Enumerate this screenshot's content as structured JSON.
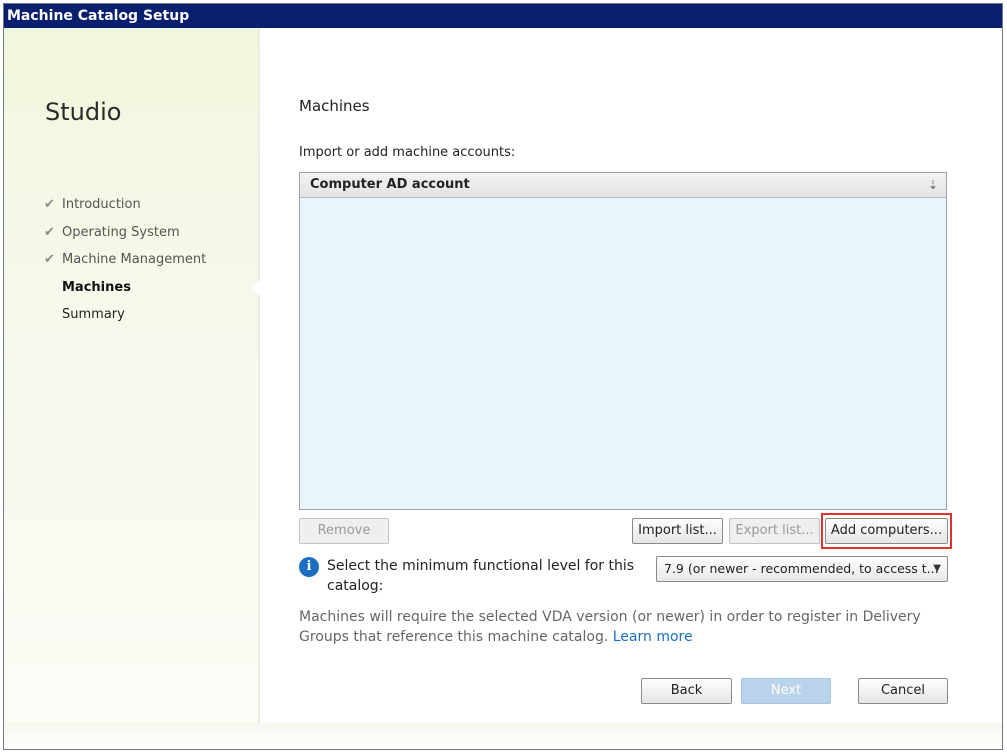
{
  "window": {
    "title": "Machine Catalog Setup"
  },
  "sidebar": {
    "app_name": "Studio",
    "steps": [
      {
        "label": "Introduction",
        "state": "done"
      },
      {
        "label": "Operating System",
        "state": "done"
      },
      {
        "label": "Machine Management",
        "state": "done"
      },
      {
        "label": "Machines",
        "state": "current"
      },
      {
        "label": "Summary",
        "state": "pending"
      }
    ],
    "check_glyph": "✔"
  },
  "main": {
    "heading": "Machines",
    "intro": "Import or add machine accounts:",
    "table": {
      "columns": [
        "Computer AD account"
      ],
      "rows": []
    },
    "buttons": {
      "remove": "Remove",
      "import_list": "Import list...",
      "export_list": "Export list...",
      "add_computers": "Add computers..."
    },
    "functional_level": {
      "label": "Select the minimum functional level for this catalog:",
      "selected": "7.9 (or newer - recommended, to access t..."
    },
    "note": {
      "text": "Machines will require the selected VDA version (or newer) in order to register in Delivery Groups that reference this machine catalog.",
      "link": "Learn more"
    }
  },
  "footer": {
    "back": "Back",
    "next": "Next",
    "cancel": "Cancel"
  },
  "colors": {
    "titlebar": "#0a1f6e",
    "highlight": "#e0322c",
    "link": "#1a6fc9",
    "info": "#1b6ec2"
  }
}
